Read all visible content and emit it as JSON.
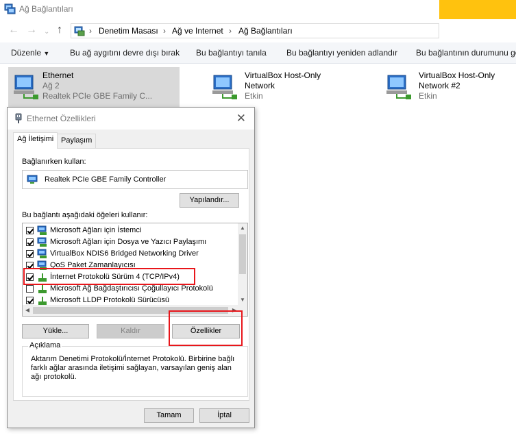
{
  "window": {
    "title": "Ağ Bağlantıları",
    "accent_color": "#ffc20e"
  },
  "nav": {
    "back_icon": "arrow-left",
    "forward_icon": "arrow-right",
    "recent_icon": "chevron-down",
    "up_icon": "arrow-up",
    "breadcrumb": [
      "Denetim Masası",
      "Ağ ve Internet",
      "Ağ Bağlantıları"
    ]
  },
  "toolbar": {
    "organize": "Düzenle",
    "disable": "Bu ağ aygıtını devre dışı bırak",
    "diagnose": "Bu bağlantıyı tanıla",
    "rename": "Bu bağlantıyı yeniden adlandır",
    "status": "Bu bağlantının durumunu gö"
  },
  "connections": [
    {
      "name": "Ethernet",
      "network": "Ağ 2",
      "device": "Realtek PCIe GBE Family C..."
    },
    {
      "name": "VirtualBox Host-Only",
      "network": "Network",
      "device": "Etkin"
    },
    {
      "name": "VirtualBox Host-Only",
      "network": "Network #2",
      "device": "Etkin"
    }
  ],
  "dialog": {
    "title": "Ethernet Özellikleri",
    "tabs": [
      "Ağ İletişimi",
      "Paylaşım"
    ],
    "connect_using_label": "Bağlanırken kullan:",
    "adapter": "Realtek PCIe GBE Family Controller",
    "configure_button": "Yapılandır...",
    "items_label": "Bu bağlantı aşağıdaki öğeleri kullanır:",
    "items": [
      {
        "label": "Microsoft Ağları için İstemci",
        "checked": true,
        "icon": "network-client-icon"
      },
      {
        "label": "Microsoft Ağları için Dosya ve Yazıcı Paylaşımı",
        "checked": true,
        "icon": "network-service-icon"
      },
      {
        "label": "VirtualBox NDIS6 Bridged Networking Driver",
        "checked": true,
        "icon": "network-service-icon"
      },
      {
        "label": "QoS Paket Zamanlayıcısı",
        "checked": true,
        "icon": "network-service-icon"
      },
      {
        "label": "İnternet Protokolü Sürüm 4 (TCP/IPv4)",
        "checked": true,
        "icon": "protocol-icon"
      },
      {
        "label": "Microsoft Ağ Bağdaştırıcısı Çoğullayıcı Protokolü",
        "checked": false,
        "icon": "protocol-icon"
      },
      {
        "label": "Microsoft LLDP Protokolü Sürücüsü",
        "checked": true,
        "icon": "protocol-icon"
      }
    ],
    "install_button": "Yükle...",
    "uninstall_button": "Kaldır",
    "properties_button": "Özellikler",
    "description_title": "Açıklama",
    "description_text": "Aktarım Denetimi Protokolü/İnternet Protokolü. Birbirine bağlı farklı ağlar arasında iletişimi sağlayan, varsayılan geniş alan ağı protokolü.",
    "ok_button": "Tamam",
    "cancel_button": "İptal"
  },
  "highlight_color": "#e8161b"
}
